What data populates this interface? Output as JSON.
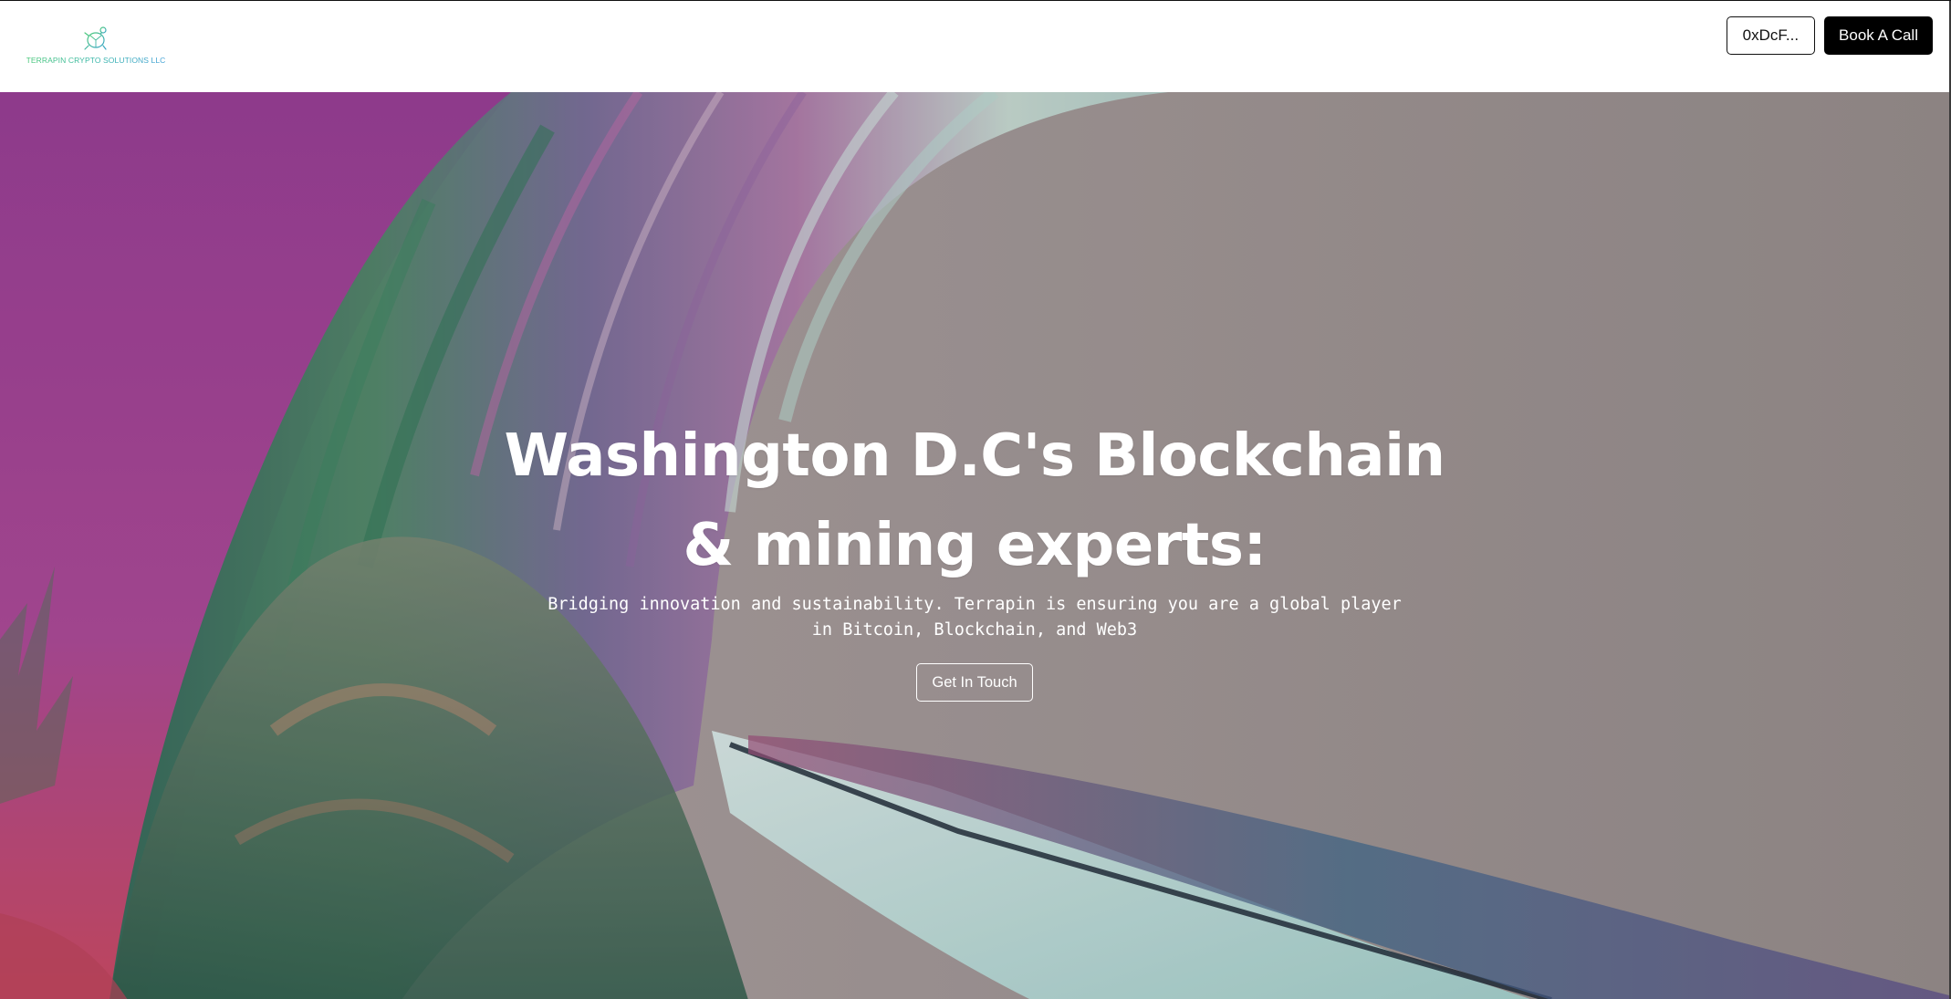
{
  "header": {
    "logo_text": "TERRAPIN CRYPTO SOLUTIONS LLC",
    "logo_icon": "turtle-icon",
    "wallet_label": "0xDcF...",
    "book_call_label": "Book A Call"
  },
  "hero": {
    "title_line1": "Washington D.C's Blockchain",
    "title_line2": "& mining experts:",
    "subtitle": "Bridging innovation and sustainability. Terrapin is ensuring you are a global player in Bitcoin, Blockchain, and Web3",
    "cta_label": "Get In Touch"
  },
  "colors": {
    "logo_gradient_start": "#48c778",
    "logo_gradient_end": "#3f9fd6",
    "hero_sky": "#a69c99",
    "hero_magenta": "#a8449f",
    "call_button_bg": "#000000"
  }
}
